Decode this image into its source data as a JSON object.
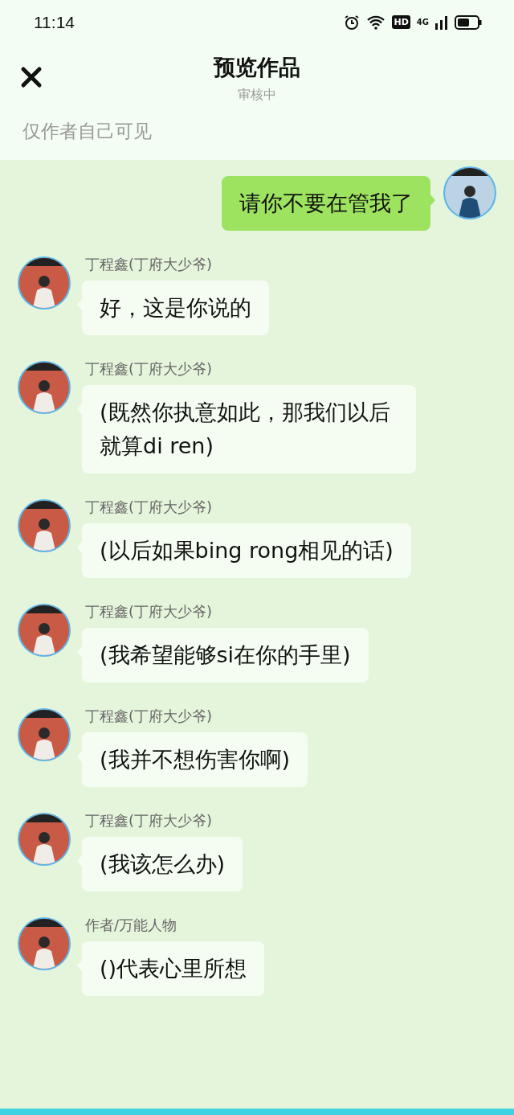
{
  "status_bar": {
    "time": "11:14",
    "hd": "HD",
    "network": "4G"
  },
  "header": {
    "title": "预览作品",
    "subtitle": "审核中",
    "notice": "仅作者自己可见"
  },
  "messages": [
    {
      "kind": "right",
      "text": "请你不要在管我了"
    },
    {
      "kind": "left",
      "sender": "丁程鑫(丁府大少爷)",
      "text": "好，这是你说的"
    },
    {
      "kind": "left",
      "sender": "丁程鑫(丁府大少爷)",
      "text": "(既然你执意如此，那我们以后就算di ren)"
    },
    {
      "kind": "left",
      "sender": "丁程鑫(丁府大少爷)",
      "text": "(以后如果bing rong相见的话)"
    },
    {
      "kind": "left",
      "sender": "丁程鑫(丁府大少爷)",
      "text": "(我希望能够si在你的手里)"
    },
    {
      "kind": "left",
      "sender": "丁程鑫(丁府大少爷)",
      "text": "(我并不想伤害你啊)"
    },
    {
      "kind": "left",
      "sender": "丁程鑫(丁府大少爷)",
      "text": "(我该怎么办)"
    },
    {
      "kind": "left",
      "sender": "作者/万能人物",
      "text": "()代表心里所想"
    }
  ]
}
